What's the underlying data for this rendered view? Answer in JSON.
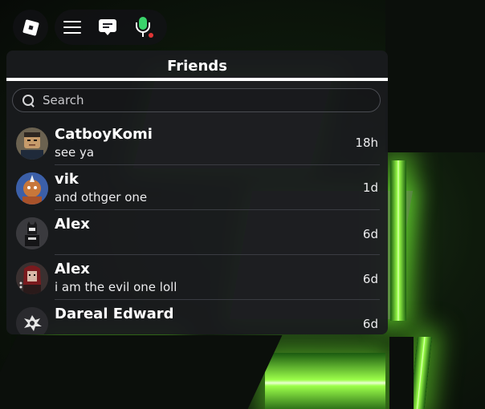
{
  "topbar": {
    "logo_icon": "roblox-logo-icon",
    "menu_icon": "hamburger-menu-icon",
    "chat_icon": "chat-bubble-icon",
    "mic_icon": "microphone-icon",
    "mic_color": "#3ad36b",
    "mic_status_color": "#e03535"
  },
  "friends_panel": {
    "title": "Friends",
    "search": {
      "placeholder": "Search",
      "value": ""
    },
    "items": [
      {
        "name": "CatboyKomi",
        "message": "see ya",
        "time": "18h",
        "avatar_bg": "#7a6a55"
      },
      {
        "name": "vik",
        "message": "and othger one",
        "time": "1d",
        "avatar_bg": "#3b5fa8"
      },
      {
        "name": "Alex",
        "message": "",
        "time": "6d",
        "avatar_bg": "#3a3a3e"
      },
      {
        "name": "Alex",
        "message": "i am the evil one loll",
        "time": "6d",
        "avatar_bg": "#4a2a2a"
      },
      {
        "name": "Dareal Edward",
        "message": "",
        "time": "6d",
        "avatar_bg": "#2a2a2e"
      }
    ]
  }
}
